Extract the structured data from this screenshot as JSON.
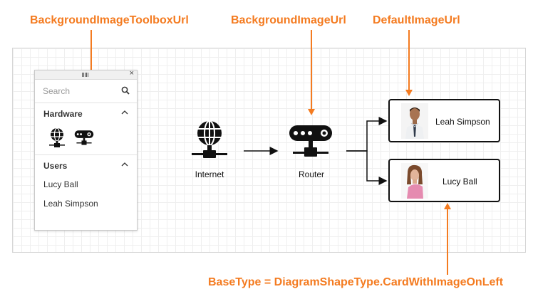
{
  "callouts": {
    "toolbox_url": "BackgroundImageToolboxUrl",
    "background_url": "BackgroundImageUrl",
    "default_url": "DefaultImageUrl",
    "base_type": "BaseType = DiagramShapeType.CardWithImageOnLeft"
  },
  "toolbox": {
    "search_placeholder": "Search",
    "groups": [
      {
        "title": "Hardware",
        "shapes": [
          "globe-icon",
          "router-icon"
        ]
      },
      {
        "title": "Users",
        "items": [
          "Lucy Ball",
          "Leah Simpson"
        ]
      }
    ],
    "close_icon": "close-icon",
    "grip_icon": "drag-grip-icon"
  },
  "diagram": {
    "shapes": [
      {
        "label": "Internet",
        "icon": "globe-icon"
      },
      {
        "label": "Router",
        "icon": "router-icon"
      }
    ],
    "cards": [
      {
        "name": "Leah Simpson",
        "photo": "man-photo"
      },
      {
        "name": "Lucy Ball",
        "photo": "woman-photo"
      }
    ]
  },
  "colors": {
    "callout": "#f47b20",
    "connector": "#111111",
    "grid": "#efefef"
  }
}
